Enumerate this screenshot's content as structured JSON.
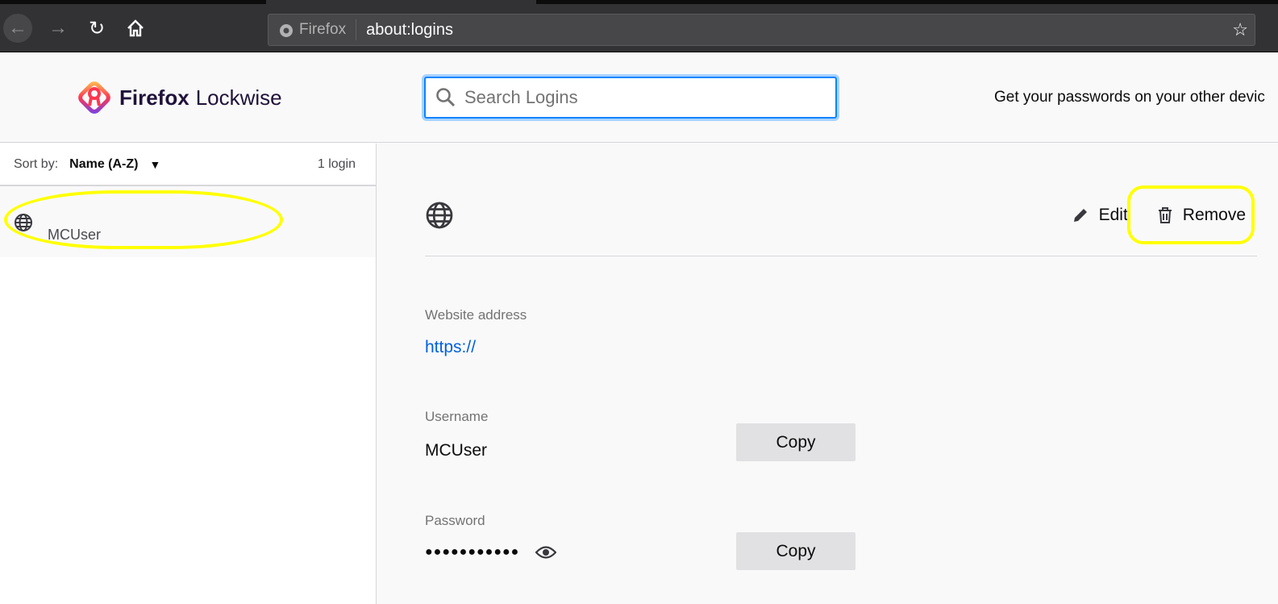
{
  "browser": {
    "identity_label": "Firefox",
    "url": "about:logins"
  },
  "header": {
    "brand_bold": "Firefox",
    "brand_light": "Lockwise",
    "search_placeholder": "Search Logins",
    "promo": "Get your passwords on your other devic"
  },
  "sidebar": {
    "sort_label": "Sort by:",
    "sort_value": "Name (A-Z)",
    "count": "1 login",
    "items": [
      {
        "username": "MCUser"
      }
    ]
  },
  "detail": {
    "edit_label": "Edit",
    "remove_label": "Remove",
    "website_label": "Website address",
    "website_value": "https://",
    "username_label": "Username",
    "username_value": "MCUser",
    "password_label": "Password",
    "password_value": "●●●●●●●●●●●",
    "copy_label": "Copy"
  },
  "colors": {
    "accent": "#0a84ff",
    "highlight": "#ffff00",
    "link": "#0060df"
  }
}
